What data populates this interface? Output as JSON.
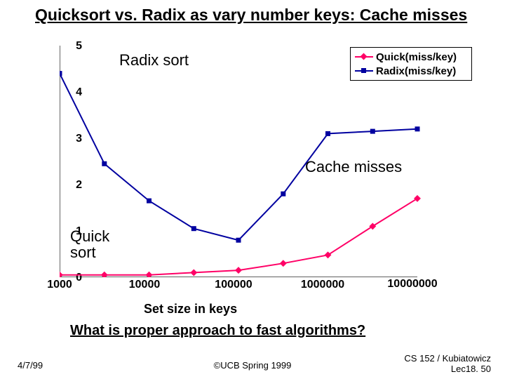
{
  "title": "Quicksort vs. Radix as vary number keys: Cache misses",
  "subquestion": "What is proper approach to fast algorithms?",
  "footer": {
    "left": "4/7/99",
    "center": "©UCB Spring 1999",
    "right_top": "CS 152 / Kubiatowicz",
    "right_bottom": "Lec18. 50"
  },
  "annotations": {
    "radix": "Radix sort",
    "quick": "Quick\nsort",
    "cache": "Cache misses"
  },
  "xlabel": "Set size in keys",
  "legend": {
    "s0": "Quick(miss/key)",
    "s1": "Radix(miss/key)"
  },
  "colors": {
    "quick": "#ff0066",
    "radix": "#0000a0"
  },
  "chart_data": {
    "type": "line",
    "xlabel": "Set size in keys",
    "ylabel": "",
    "ylim": [
      0,
      5
    ],
    "xlim_log10": [
      3,
      7
    ],
    "x_ticks": [
      "1000",
      "10000",
      "100000",
      "1000000",
      "10000000"
    ],
    "y_ticks": [
      "0",
      "1",
      "2",
      "3",
      "4",
      "5"
    ],
    "categories_log10": [
      3.0,
      3.5,
      4.0,
      4.5,
      5.0,
      5.5,
      6.0,
      6.5,
      7.0
    ],
    "series": [
      {
        "name": "Quick(miss/key)",
        "color": "#ff0066",
        "values": [
          0.05,
          0.05,
          0.05,
          0.1,
          0.15,
          0.3,
          0.48,
          1.1,
          1.7
        ]
      },
      {
        "name": "Radix(miss/key)",
        "color": "#0000a0",
        "values": [
          4.4,
          2.45,
          1.65,
          1.05,
          0.8,
          1.8,
          3.1,
          3.15,
          3.2
        ]
      }
    ]
  }
}
